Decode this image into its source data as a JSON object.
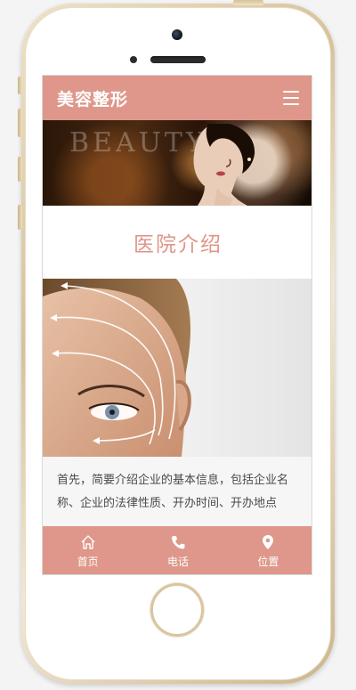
{
  "header": {
    "site_title": "美容整形",
    "menu_icon": "hamburger-menu-icon"
  },
  "banner": {
    "text": "BEAUTY"
  },
  "section": {
    "title": "医院介绍",
    "intro_text": "首先，简要介绍企业的基本信息，包括企业名称、企业的法律性质、开办时间、开办地点"
  },
  "footer": {
    "items": [
      {
        "label": "首页",
        "icon": "home-icon"
      },
      {
        "label": "电话",
        "icon": "phone-icon"
      },
      {
        "label": "位置",
        "icon": "location-pin-icon"
      }
    ]
  },
  "colors": {
    "accent": "#de978a",
    "text": "#4a4a4a",
    "section_bg": "#f6f6f7"
  }
}
